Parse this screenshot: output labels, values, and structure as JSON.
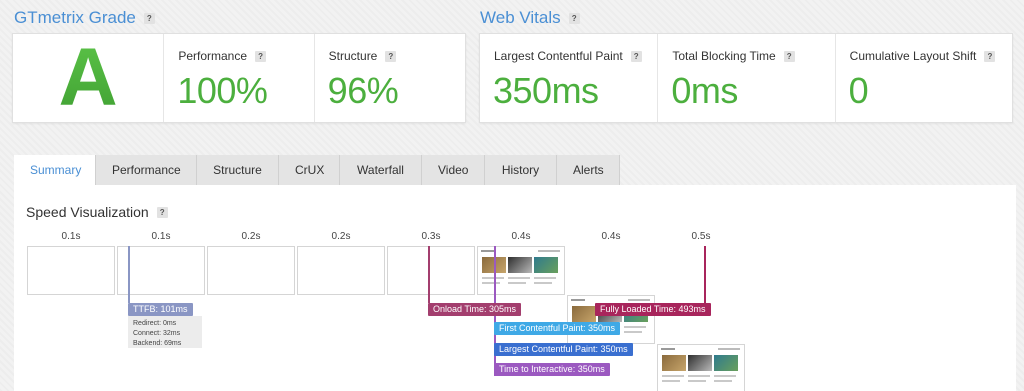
{
  "grade_section": {
    "title": "GTmetrix Grade",
    "grade": "A",
    "metrics": [
      {
        "label": "Performance",
        "value": "100%"
      },
      {
        "label": "Structure",
        "value": "96%"
      }
    ]
  },
  "vitals_section": {
    "title": "Web Vitals",
    "metrics": [
      {
        "label": "Largest Contentful Paint",
        "value": "350ms"
      },
      {
        "label": "Total Blocking Time",
        "value": "0ms"
      },
      {
        "label": "Cumulative Layout Shift",
        "value": "0"
      }
    ]
  },
  "help_glyph": "?",
  "tabs": [
    "Summary",
    "Performance",
    "Structure",
    "CrUX",
    "Waterfall",
    "Video",
    "History",
    "Alerts"
  ],
  "active_tab": "Summary",
  "speed": {
    "title": "Speed Visualization",
    "frame_times": [
      "0.1s",
      "0.1s",
      "0.2s",
      "0.2s",
      "0.3s",
      "0.4s",
      "0.4s",
      "0.5s"
    ],
    "ttfb": {
      "label": "TTFB: 101ms",
      "details": [
        "Redirect: 0ms",
        "Connect: 32ms",
        "Backend: 69ms"
      ]
    },
    "markers": [
      {
        "label": "Onload Time: 305ms",
        "color": "#a33e6e"
      },
      {
        "label": "Fully Loaded Time: 493ms",
        "color": "#a8255c"
      },
      {
        "label": "First Contentful Paint: 350ms",
        "color": "#3fa9e6"
      },
      {
        "label": "Largest Contentful Paint: 350ms",
        "color": "#3a6fd0"
      },
      {
        "label": "Time to Interactive: 350ms",
        "color": "#9b59c0"
      }
    ],
    "ttfb_color": "#8a96c4"
  },
  "colors": {
    "accent": "#4a8fd4",
    "good": "#4caf3e"
  }
}
